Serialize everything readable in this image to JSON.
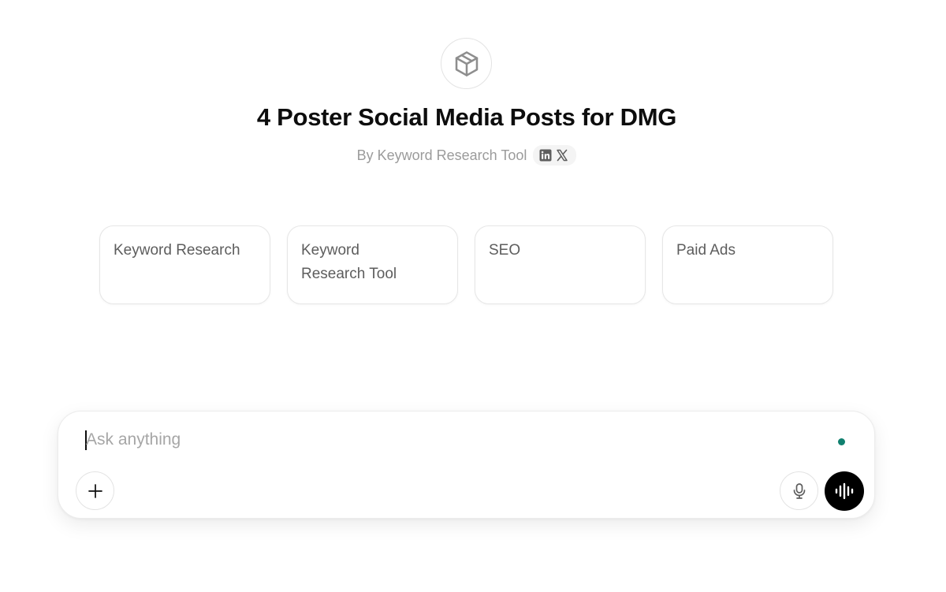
{
  "gpt": {
    "icon": "cube-icon",
    "title": "4 Poster Social Media Posts for DMG",
    "byline": "By Keyword Research Tool",
    "social_icons": [
      "linkedin-icon",
      "x-icon"
    ]
  },
  "starters": [
    {
      "label": "Keyword Research"
    },
    {
      "label": "Keyword Research Tool"
    },
    {
      "label": "SEO"
    },
    {
      "label": "Paid Ads"
    }
  ],
  "composer": {
    "placeholder": "Ask anything",
    "value": "",
    "status_color": "#10806f",
    "buttons": {
      "attach_icon": "plus-icon",
      "dictate_icon": "microphone-icon",
      "voice_icon": "voice-waveform-icon"
    }
  }
}
